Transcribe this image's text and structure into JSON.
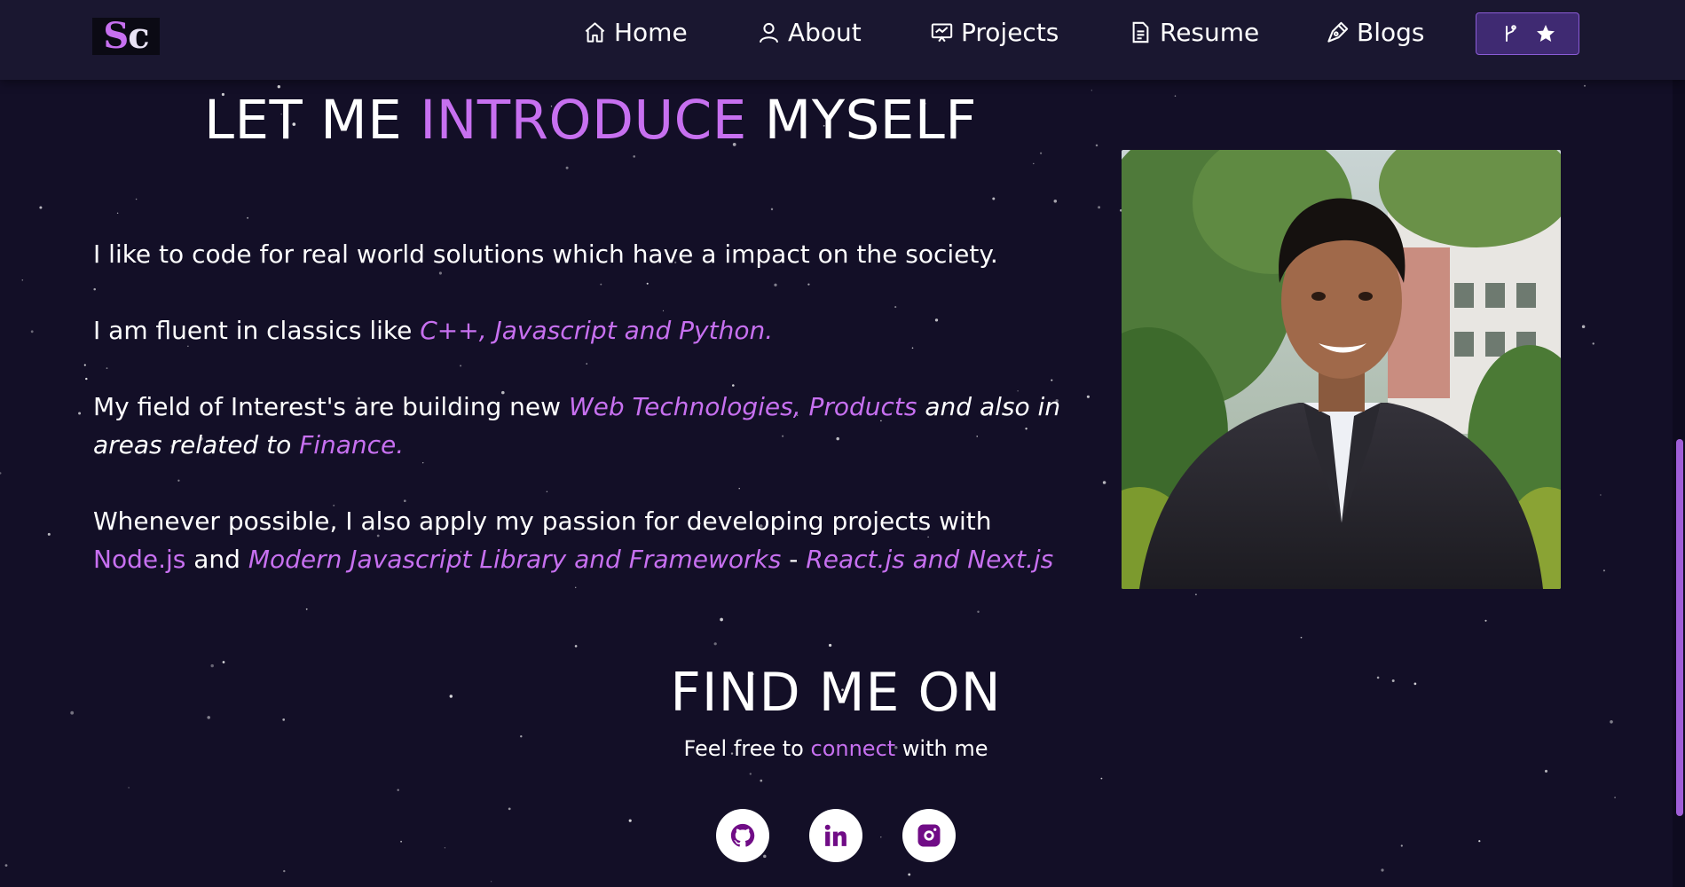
{
  "nav": {
    "logo_main": "S",
    "logo_accent": "c",
    "items": [
      {
        "label": "Home",
        "icon": "home-icon"
      },
      {
        "label": "About",
        "icon": "user-icon"
      },
      {
        "label": "Projects",
        "icon": "projects-icon"
      },
      {
        "label": "Resume",
        "icon": "document-icon"
      },
      {
        "label": "Blogs",
        "icon": "pen-icon"
      }
    ],
    "fork_button": {
      "icons": [
        "git-fork-icon",
        "star-icon"
      ]
    }
  },
  "intro": {
    "heading_part1": "LET ME ",
    "heading_highlight": "INTRODUCE",
    "heading_part2": " MYSELF",
    "p1": "I like to code for real world solutions which have a impact on the society.",
    "p2_prefix": "I am fluent in classics like ",
    "p2_highlight": "C++, Javascript and Python.",
    "p3_prefix": "My field of Interest's are building new ",
    "p3_highlight1": "Web Technologies, Products",
    "p3_mid": " and also in areas related to ",
    "p3_highlight2": "Finance.",
    "p4_prefix": "Whenever possible, I also apply my passion for developing projects with ",
    "p4_highlight1": "Node.js",
    "p4_and": " and ",
    "p4_highlight2": "Modern Javascript Library and Frameworks",
    "p4_dash": " - ",
    "p4_highlight3": "React.js and Next.js"
  },
  "find": {
    "title": "FIND ME ON",
    "subtitle_prefix": "Feel free to ",
    "subtitle_highlight": "connect",
    "subtitle_suffix": " with me",
    "socials": [
      "github-icon",
      "linkedin-icon",
      "instagram-icon"
    ]
  },
  "colors": {
    "background": "#130f27",
    "navbar": "#1a1730",
    "accent": "#c770f0",
    "button": "#3f2a72",
    "social_icon": "#700c86"
  }
}
